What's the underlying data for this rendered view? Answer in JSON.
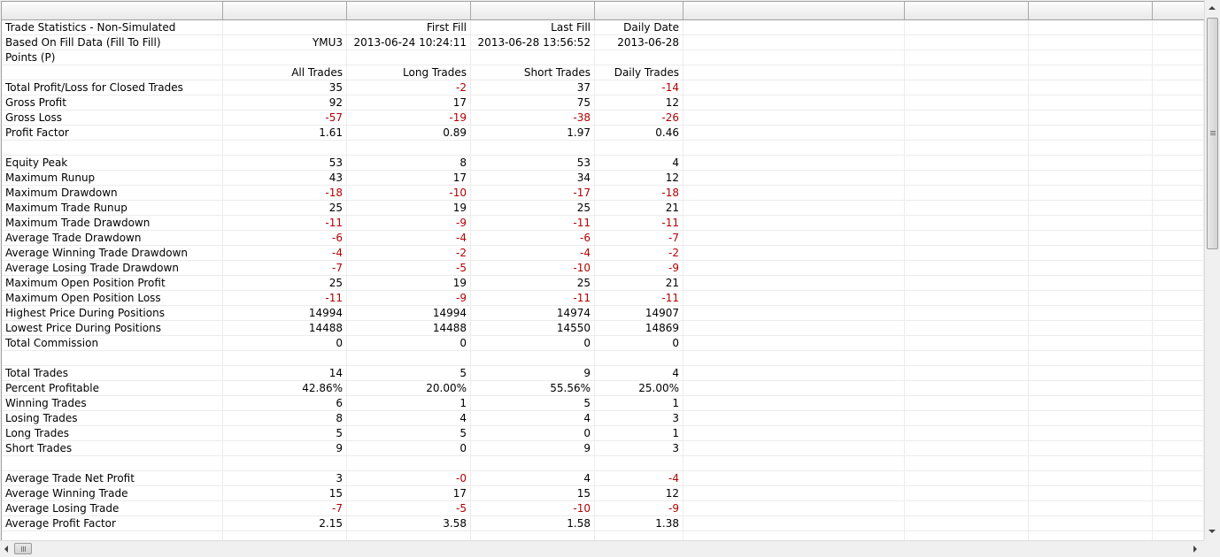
{
  "header": {
    "name_col": "Trade Statistics - Non-Simulated",
    "subtitle": "Based On Fill Data (Fill To Fill)",
    "units": "Points (P)",
    "symbol": "YMU3",
    "first_fill_label": "First Fill",
    "first_fill_value": "2013-06-24  10:24:11",
    "last_fill_label": "Last Fill",
    "last_fill_value": "2013-06-28  13:56:52",
    "daily_date_label": "Daily Date",
    "daily_date_value": "2013-06-28"
  },
  "columns": [
    "All Trades",
    "Long Trades",
    "Short Trades",
    "Daily Trades"
  ],
  "sections": [
    [
      {
        "label": "Total Profit/Loss for Closed Trades",
        "values": [
          "35",
          "-2",
          "37",
          "-14"
        ]
      },
      {
        "label": "Gross Profit",
        "values": [
          "92",
          "17",
          "75",
          "12"
        ]
      },
      {
        "label": "Gross Loss",
        "values": [
          "-57",
          "-19",
          "-38",
          "-26"
        ]
      },
      {
        "label": "Profit Factor",
        "values": [
          "1.61",
          "0.89",
          "1.97",
          "0.46"
        ]
      }
    ],
    [
      {
        "label": "Equity Peak",
        "values": [
          "53",
          "8",
          "53",
          "4"
        ]
      },
      {
        "label": "Maximum Runup",
        "values": [
          "43",
          "17",
          "34",
          "12"
        ]
      },
      {
        "label": "Maximum Drawdown",
        "values": [
          "-18",
          "-10",
          "-17",
          "-18"
        ]
      },
      {
        "label": "Maximum Trade Runup",
        "values": [
          "25",
          "19",
          "25",
          "21"
        ]
      },
      {
        "label": "Maximum Trade Drawdown",
        "values": [
          "-11",
          "-9",
          "-11",
          "-11"
        ]
      },
      {
        "label": "Average Trade Drawdown",
        "values": [
          "-6",
          "-4",
          "-6",
          "-7"
        ]
      },
      {
        "label": "Average Winning Trade Drawdown",
        "values": [
          "-4",
          "-2",
          "-4",
          "-2"
        ]
      },
      {
        "label": "Average Losing Trade Drawdown",
        "values": [
          "-7",
          "-5",
          "-10",
          "-9"
        ]
      },
      {
        "label": "Maximum Open Position Profit",
        "values": [
          "25",
          "19",
          "25",
          "21"
        ]
      },
      {
        "label": "Maximum Open Position Loss",
        "values": [
          "-11",
          "-9",
          "-11",
          "-11"
        ]
      },
      {
        "label": "Highest Price During Positions",
        "values": [
          "14994",
          "14994",
          "14974",
          "14907"
        ]
      },
      {
        "label": "Lowest Price During Positions",
        "values": [
          "14488",
          "14488",
          "14550",
          "14869"
        ]
      },
      {
        "label": "Total Commission",
        "values": [
          "0",
          "0",
          "0",
          "0"
        ]
      }
    ],
    [
      {
        "label": "Total Trades",
        "values": [
          "14",
          "5",
          "9",
          "4"
        ]
      },
      {
        "label": "Percent Profitable",
        "values": [
          "42.86%",
          "20.00%",
          "55.56%",
          "25.00%"
        ]
      },
      {
        "label": "Winning Trades",
        "values": [
          "6",
          "1",
          "5",
          "1"
        ]
      },
      {
        "label": "Losing Trades",
        "values": [
          "8",
          "4",
          "4",
          "3"
        ]
      },
      {
        "label": "Long Trades",
        "values": [
          "5",
          "5",
          "0",
          "1"
        ]
      },
      {
        "label": "Short Trades",
        "values": [
          "9",
          "0",
          "9",
          "3"
        ]
      }
    ],
    [
      {
        "label": "Average Trade Net Profit",
        "values": [
          "3",
          "-0",
          "4",
          "-4"
        ]
      },
      {
        "label": "Average Winning Trade",
        "values": [
          "15",
          "17",
          "15",
          "12"
        ]
      },
      {
        "label": "Average Losing Trade",
        "values": [
          "-7",
          "-5",
          "-10",
          "-9"
        ]
      },
      {
        "label": "Average Profit Factor",
        "values": [
          "2.15",
          "3.58",
          "1.58",
          "1.38"
        ]
      }
    ]
  ],
  "colors": {
    "negative": "#b40000",
    "text": "#000000",
    "gridline": "#ececec"
  },
  "icons": {
    "scroll_up": "arrow-up-icon",
    "scroll_down": "arrow-down-icon",
    "scroll_left": "arrow-left-icon",
    "scroll_right": "arrow-right-icon"
  }
}
